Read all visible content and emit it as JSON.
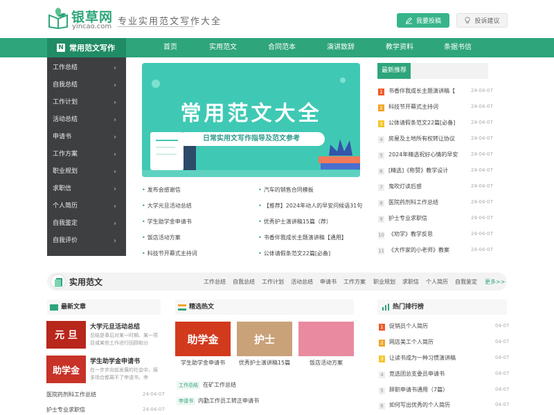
{
  "header": {
    "logo_name": "银草网",
    "logo_domain": "yincao.com",
    "tagline": "专业实用范文写作大全",
    "contribute_label": "我要投稿",
    "feedback_label": "投诉建议"
  },
  "nav": {
    "brand": "常用范文写作",
    "items": [
      "首页",
      "实用范文",
      "合同范本",
      "演讲致辞",
      "教学资料",
      "条据书信"
    ]
  },
  "sidebar": {
    "items": [
      "工作总结",
      "自我总结",
      "工作计划",
      "活动总结",
      "申请书",
      "工作方案",
      "职业规划",
      "求职信",
      "个人简历",
      "自我鉴定",
      "自我评价"
    ]
  },
  "banner": {
    "title": "常用范文大全",
    "subtitle": "日常实用文写作指导及范文参考"
  },
  "banner_links": {
    "left": [
      "发布会感谢信",
      "大学元旦活动总结",
      "学生助学金申请书",
      "饭店活动方案",
      "科技节开幕式主持词"
    ],
    "right": [
      "汽车的销售合同模板",
      "【推荐】2024年动人的早安问候语31句",
      "优秀护士演讲稿15篇（荐）",
      "书香伴我成长主题演讲稿【通用】",
      "公体请假条范文22篇[必备]"
    ]
  },
  "recommend": {
    "title": "最新推荐",
    "items": [
      {
        "num": "1",
        "text": "书香伴我成长主题演讲稿【",
        "date": "24-04-07"
      },
      {
        "num": "2",
        "text": "科技节开幕式主持词",
        "date": "24-04-07"
      },
      {
        "num": "3",
        "text": "公体请假条范文22篇[必备]",
        "date": "24-04-07"
      },
      {
        "num": "4",
        "text": "房屋及土地所有权转让协议",
        "date": "24-04-07"
      },
      {
        "num": "5",
        "text": "2024年精选祝好心情的早安",
        "date": "24-04-07"
      },
      {
        "num": "6",
        "text": "[精选]《称赞》教学设计",
        "date": "24-04-07"
      },
      {
        "num": "7",
        "text": "鬼吹灯读后感",
        "date": "24-04-07"
      },
      {
        "num": "8",
        "text": "医院药剂科工作总结",
        "date": "24-04-07"
      },
      {
        "num": "9",
        "text": "护士专业求职信",
        "date": "24-04-07"
      },
      {
        "num": "10",
        "text": "《劝学》教学反思",
        "date": "24-04-07"
      },
      {
        "num": "11",
        "text": "《大作家的小老师》教案",
        "date": "24-04-07"
      }
    ]
  },
  "section": {
    "title": "实用范文",
    "links": [
      "工作总结",
      "自我总结",
      "工作计划",
      "活动总结",
      "申请书",
      "工作方案",
      "职业规划",
      "求职信",
      "个人简历",
      "自我鉴定"
    ],
    "more": "更多>>"
  },
  "latest": {
    "title": "最新文章",
    "articles": [
      {
        "thumb": "元 旦",
        "title": "大学元旦活动总结",
        "desc": "总结是事后对某一时期、某一项目或某些工作进行回顾和分"
      },
      {
        "thumb": "助学金",
        "title": "学生助学金申请书",
        "desc": "在一步步向前发展的社会中，报多场合都离不了申请书，申"
      }
    ],
    "list": [
      {
        "text": "医院药剂科工作总结",
        "date": "24-04-07"
      },
      {
        "text": "护士专业求职信",
        "date": "24-04-07"
      }
    ]
  },
  "featured": {
    "title": "精选热文",
    "images": [
      {
        "thumb": "助学金",
        "caption": "学生助学金申请书"
      },
      {
        "thumb": "护士",
        "caption": "优秀护士演讲稿15篇"
      },
      {
        "thumb": "",
        "caption": "饭店活动方案"
      }
    ],
    "list": [
      {
        "tag": "工作总结",
        "text": "在矿工作总结"
      },
      {
        "tag": "申请书",
        "text": "内勤工作员工转正申请书"
      }
    ]
  },
  "ranking": {
    "title": "热门排行榜",
    "items": [
      {
        "num": "1",
        "text": "促销员个人简历",
        "date": "04-07"
      },
      {
        "num": "2",
        "text": "网店美工个人简历",
        "date": "04-07"
      },
      {
        "num": "3",
        "text": "让读书成为一种习惯演讲稿",
        "date": "04-07"
      },
      {
        "num": "4",
        "text": "竞选团总支委员申请书",
        "date": "04-07"
      },
      {
        "num": "5",
        "text": "辞职申请书通用（7篇）",
        "date": "04-07"
      },
      {
        "num": "6",
        "text": "如何写出优秀的个人简历",
        "date": "04-07"
      }
    ]
  },
  "colors": {
    "brand": "#2ea57b",
    "sidebar_bg": "#3e3f40",
    "banner_bg": "#3fc9b4",
    "hot1": "#f05a28",
    "hot2": "#f3a42a",
    "hot3": "#f3c62a"
  }
}
